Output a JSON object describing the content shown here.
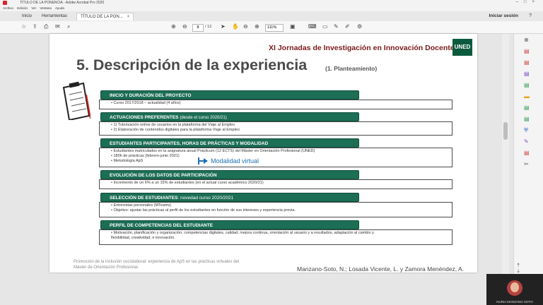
{
  "window": {
    "title": "TÍTULO DE LA PONENCIA - Adobe Acrobat Pro 2020"
  },
  "menu": [
    "Archivo",
    "Edición",
    "Ver",
    "Ventana",
    "Ayuda"
  ],
  "tabs": [
    {
      "label": "Inicio"
    },
    {
      "label": "Herramientas"
    },
    {
      "label": "TÍTULO DE LA PON...",
      "close": "×"
    }
  ],
  "account": {
    "signin_label": "Iniciar sesión"
  },
  "toolbar": {
    "page_current": "8",
    "page_total": "/ 12",
    "zoom": "111%"
  },
  "slide": {
    "header": "XI Jornadas de Investigación en Innovación Docente",
    "logo": "UNED",
    "title": "5. Descripción de la experiencia",
    "subtitle": "(1. Planteamiento)",
    "sections": [
      {
        "head": "INICIO Y DURACIÓN DEL PROYECTO",
        "items": [
          "•  Curso 2017/2018 – actualidad (4 años)"
        ]
      },
      {
        "head": "ACTUACIONES PREFERENTES",
        "head_sub": "(desde el curso 2020/21)",
        "items": [
          "•  1) Tutorización online de usuarios en la plataforma del Viaje al Empleo",
          "•  2) Elaboración de contenidos digitales para la plataforma Viaje al Empleo"
        ]
      },
      {
        "head": "ESTUDIANTES PARTICIPANTES, HORAS DE PRÁCTICAS Y MODALIDAD",
        "items": [
          "•  Estudiantes matriculados en la asignatura anual Prácticum (12 ECTS) del Máster en Orientación Profesional (UNED)",
          "•  180h de prácticas (febrero-junio 2021)",
          "•  Metodología ApS"
        ]
      },
      {
        "head": "EVOLUCIÓN DE LOS DATOS DE PARTICIPACIÓN",
        "items": [
          "•  Incremento de un 6% a un 15% de estudiantes (en el actual curso académico 2020/21)"
        ]
      },
      {
        "head": "SELECCIÓN DE ESTUDIANTES",
        "head_sub": ": novedad curso 2020/2021",
        "items": [
          "•  Entrevistas personales (MTeams)",
          "•  Objetivo: ajustar las prácticas al perfil de los estudiantes en función de sus intereses y experiencia previa."
        ]
      },
      {
        "head": "PERFIL DE COMPETENCIAS DEL ESTUDIANTE",
        "items": [
          "•  Motivación, planificación y organización, competencias digitales, calidad, mejora continua, orientación al usuario y a resultados, adaptación al cambio y",
          "    flexibilidad, creatividad, e innovación."
        ]
      }
    ],
    "note": "Modalidad virtual",
    "footer_left": "Promoción de la inclusión sociolaboral: experiencia de ApS en las prácticas virtuales del Máster de Orientación Profesional.",
    "footer_right": "Manzano-Soto, N.; Losada Vicente, L. y Zamora Menéndez, A."
  },
  "video": {
    "name": "NURIA MANZANO SOTO"
  },
  "colors": {
    "section_head": "#1c6e55",
    "header_text": "#7b1a1a",
    "note_text": "#1f6fb3"
  }
}
